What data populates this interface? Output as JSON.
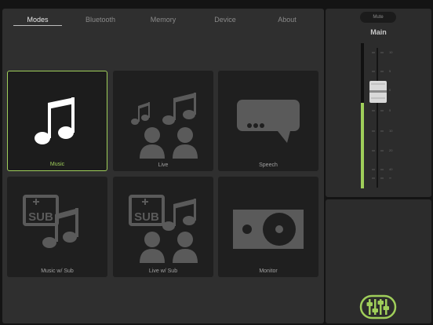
{
  "tabs": [
    {
      "label": "Modes",
      "active": true
    },
    {
      "label": "Bluetooth",
      "active": false
    },
    {
      "label": "Memory",
      "active": false
    },
    {
      "label": "Device",
      "active": false
    },
    {
      "label": "About",
      "active": false
    }
  ],
  "modes": [
    {
      "label": "Music",
      "icon": "music-note-icon",
      "selected": true
    },
    {
      "label": "Live",
      "icon": "live-audience-icon",
      "selected": false
    },
    {
      "label": "Speech",
      "icon": "speech-bubble-icon",
      "selected": false
    },
    {
      "label": "Music w/ Sub",
      "icon": "music-sub-icon",
      "selected": false
    },
    {
      "label": "Live w/ Sub",
      "icon": "live-sub-icon",
      "selected": false
    },
    {
      "label": "Monitor",
      "icon": "monitor-speaker-icon",
      "selected": false
    }
  ],
  "sub_badge": "SUB",
  "mixer": {
    "mute_label": "Mute",
    "title": "Main",
    "scale": [
      "10",
      "5",
      "0",
      "5",
      "10",
      "20",
      "40",
      "∞"
    ],
    "fader_level": 0.72
  },
  "colors": {
    "accent": "#9fce5a",
    "panel": "#2f2f2f",
    "tile": "#1f1f1f",
    "icon_dim": "#5a5a5a"
  }
}
